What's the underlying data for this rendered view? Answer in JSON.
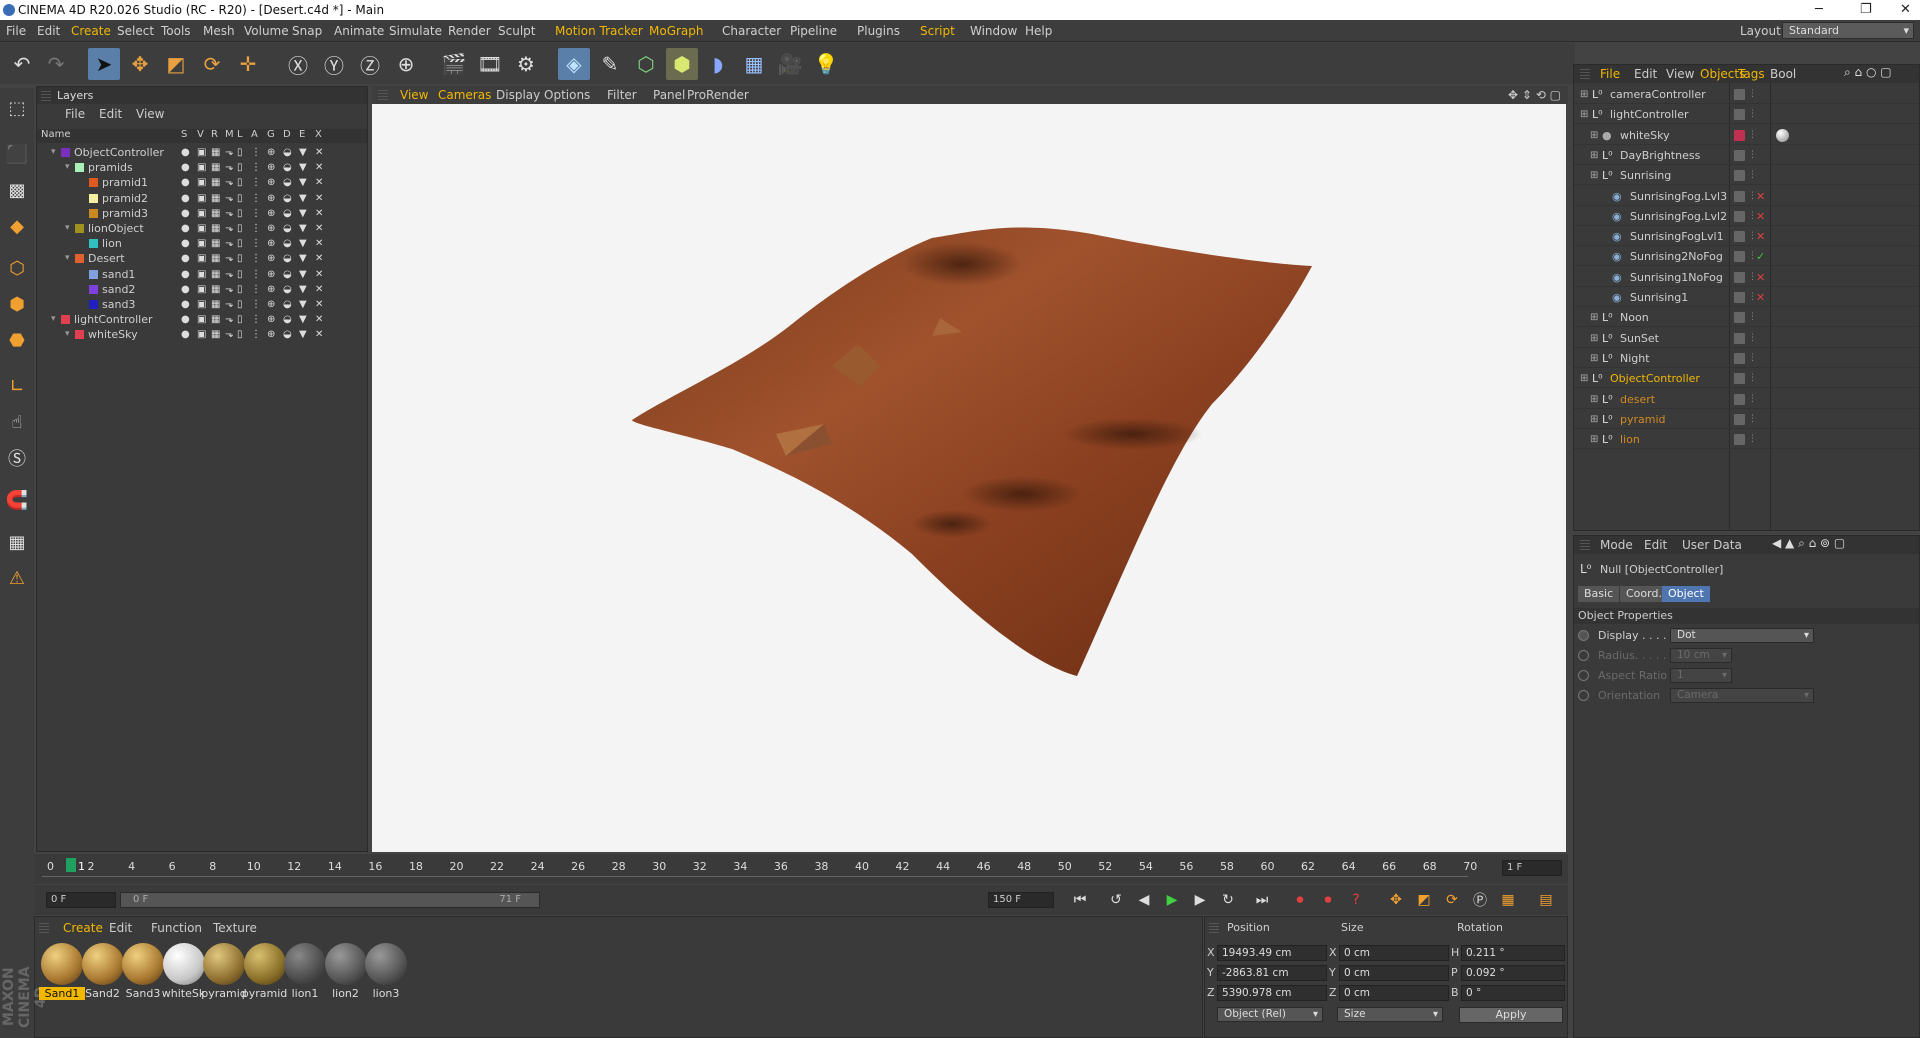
{
  "window": {
    "title": "CINEMA 4D R20.026 Studio (RC - R20) - [Desert.c4d *] - Main"
  },
  "menubar": {
    "items": [
      "File",
      "Edit",
      "Create",
      "Select",
      "Tools",
      "Mesh",
      "Volume",
      "Snap",
      "Animate",
      "Simulate",
      "Render",
      "Sculpt",
      "Motion Tracker",
      "MoGraph",
      "Character",
      "Pipeline",
      "Plugins",
      "Script",
      "Window",
      "Help"
    ],
    "layout_label": "Layout:",
    "layout_value": "Standard"
  },
  "layers": {
    "title": "Layers",
    "menu": [
      "File",
      "Edit",
      "View"
    ],
    "columns": [
      "Name",
      "S",
      "V",
      "R",
      "M",
      "L",
      "A",
      "G",
      "D",
      "E",
      "X"
    ],
    "rows": [
      {
        "name": "ObjectController",
        "color": "#7a2fbf",
        "indent": 0
      },
      {
        "name": "pramids",
        "color": "#a8f0b8",
        "indent": 1
      },
      {
        "name": "pramid1",
        "color": "#e05a20",
        "indent": 2
      },
      {
        "name": "pramid2",
        "color": "#f4f0a0",
        "indent": 2
      },
      {
        "name": "pramid3",
        "color": "#c88a20",
        "indent": 2
      },
      {
        "name": "lionObject",
        "color": "#a09020",
        "indent": 1
      },
      {
        "name": "lion",
        "color": "#30c0c0",
        "indent": 2
      },
      {
        "name": "Desert",
        "color": "#e06030",
        "indent": 1
      },
      {
        "name": "sand1",
        "color": "#80a0e0",
        "indent": 2
      },
      {
        "name": "sand2",
        "color": "#8040e0",
        "indent": 2
      },
      {
        "name": "sand3",
        "color": "#2020c0",
        "indent": 2
      },
      {
        "name": "lightController",
        "color": "#e04050",
        "indent": 0
      },
      {
        "name": "whiteSky",
        "color": "#e04050",
        "indent": 1
      }
    ]
  },
  "viewport": {
    "menu": [
      "View",
      "Cameras",
      "Display",
      "Options",
      "Filter",
      "Panel",
      "ProRender"
    ]
  },
  "timeline": {
    "ticks": [
      "0",
      "2",
      "4",
      "6",
      "8",
      "10",
      "12",
      "14",
      "16",
      "18",
      "20",
      "22",
      "24",
      "26",
      "28",
      "30",
      "32",
      "34",
      "36",
      "38",
      "40",
      "42",
      "44",
      "46",
      "48",
      "50",
      "52",
      "54",
      "56",
      "58",
      "60",
      "62",
      "64",
      "66",
      "68",
      "70"
    ],
    "current_marker": "1",
    "frame_field": "1 F"
  },
  "transport": {
    "start": "0 F",
    "range_start": "0 F",
    "range_end": "71 F",
    "end": "150 F"
  },
  "materials": {
    "menu": [
      "Create",
      "Edit",
      "Function",
      "Texture"
    ],
    "items": [
      {
        "label": "Sand1",
        "selected": true
      },
      {
        "label": "Sand2",
        "selected": false
      },
      {
        "label": "Sand3",
        "selected": false
      },
      {
        "label": "whiteSk",
        "selected": false
      },
      {
        "label": "pyramid",
        "selected": false
      },
      {
        "label": "pyramid",
        "selected": false
      },
      {
        "label": "lion1",
        "selected": false
      },
      {
        "label": "lion2",
        "selected": false
      },
      {
        "label": "lion3",
        "selected": false
      }
    ]
  },
  "coords": {
    "headers": [
      "Position",
      "Size",
      "Rotation"
    ],
    "rows": [
      {
        "axis": "X",
        "pos": "19493.49 cm",
        "saxis": "X",
        "size": "0 cm",
        "raxis": "H",
        "rot": "0.211 °"
      },
      {
        "axis": "Y",
        "pos": "-2863.81 cm",
        "saxis": "Y",
        "size": "0 cm",
        "raxis": "P",
        "rot": "0.092 °"
      },
      {
        "axis": "Z",
        "pos": "5390.978 cm",
        "saxis": "Z",
        "size": "0 cm",
        "raxis": "B",
        "rot": "0 °"
      }
    ],
    "mode_select": "Object (Rel)",
    "size_select": "Size",
    "apply": "Apply"
  },
  "objects": {
    "menu": [
      "File",
      "Edit",
      "View",
      "Objects",
      "Tags",
      "Bool"
    ],
    "rows": [
      {
        "name": "cameraController",
        "type": "null",
        "indent": 0,
        "color": "#cfcfcf",
        "tag": ""
      },
      {
        "name": "lightController",
        "type": "null",
        "indent": 0,
        "color": "#cfcfcf",
        "tag": ""
      },
      {
        "name": "whiteSky",
        "type": "sky",
        "indent": 1,
        "color": "#cfcfcf",
        "tag": "sphere"
      },
      {
        "name": "DayBrightness",
        "type": "null",
        "indent": 1,
        "color": "#cfcfcf",
        "tag": ""
      },
      {
        "name": "Sunrising",
        "type": "null",
        "indent": 1,
        "color": "#cfcfcf",
        "tag": ""
      },
      {
        "name": "SunrisingFog.Lvl3",
        "type": "env",
        "indent": 2,
        "color": "#cfcfcf",
        "tag": "x"
      },
      {
        "name": "SunrisingFog.Lvl2",
        "type": "env",
        "indent": 2,
        "color": "#cfcfcf",
        "tag": "x"
      },
      {
        "name": "SunrisingFogLvl1",
        "type": "env",
        "indent": 2,
        "color": "#cfcfcf",
        "tag": "x"
      },
      {
        "name": "Sunrising2NoFog",
        "type": "env",
        "indent": 2,
        "color": "#cfcfcf",
        "tag": "check"
      },
      {
        "name": "Sunrising1NoFog",
        "type": "env",
        "indent": 2,
        "color": "#cfcfcf",
        "tag": "x"
      },
      {
        "name": "Sunrising1",
        "type": "env",
        "indent": 2,
        "color": "#cfcfcf",
        "tag": "x"
      },
      {
        "name": "Noon",
        "type": "null",
        "indent": 1,
        "color": "#cfcfcf",
        "tag": ""
      },
      {
        "name": "SunSet",
        "type": "null",
        "indent": 1,
        "color": "#cfcfcf",
        "tag": ""
      },
      {
        "name": "Night",
        "type": "null",
        "indent": 1,
        "color": "#cfcfcf",
        "tag": ""
      },
      {
        "name": "ObjectController",
        "type": "null",
        "indent": 0,
        "color": "#f2b800",
        "tag": ""
      },
      {
        "name": "desert",
        "type": "null",
        "indent": 1,
        "color": "#d08a20",
        "tag": ""
      },
      {
        "name": "pyramid",
        "type": "null",
        "indent": 1,
        "color": "#d08a20",
        "tag": ""
      },
      {
        "name": "lion",
        "type": "null",
        "indent": 1,
        "color": "#d08a20",
        "tag": ""
      }
    ]
  },
  "attributes": {
    "menu": [
      "Mode",
      "Edit",
      "User Data"
    ],
    "object_title": "Null [ObjectController]",
    "tabs": [
      {
        "label": "Basic",
        "active": false
      },
      {
        "label": "Coord.",
        "active": false
      },
      {
        "label": "Object",
        "active": true
      }
    ],
    "section": "Object Properties",
    "props": [
      {
        "label": "Display . . . .",
        "value": "Dot",
        "enabled": true,
        "kind": "select"
      },
      {
        "label": "Radius. . . . .",
        "value": "10 cm",
        "enabled": false,
        "kind": "number"
      },
      {
        "label": "Aspect Ratio",
        "value": "1",
        "enabled": false,
        "kind": "number"
      },
      {
        "label": "Orientation",
        "value": "Camera",
        "enabled": false,
        "kind": "select"
      }
    ]
  },
  "colors": {
    "accent": "#f2b800",
    "selection_blue": "#5a7fa8",
    "panel": "#3a3a3a"
  }
}
